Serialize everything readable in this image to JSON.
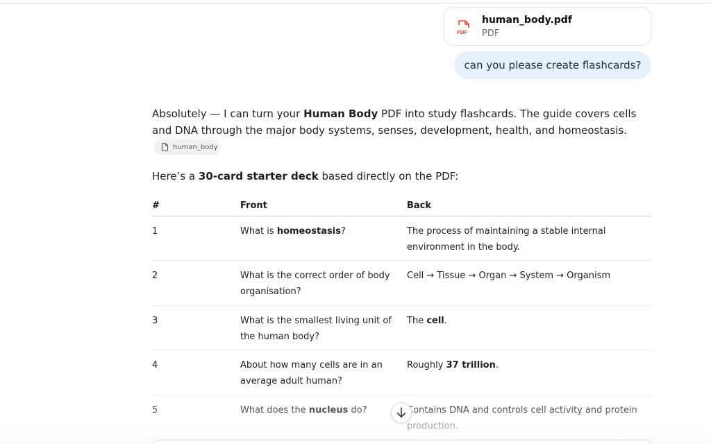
{
  "attachment": {
    "file_name": "human_body.pdf",
    "file_type": "PDF",
    "icon": "pdf-file-icon",
    "icon_label": "PDF"
  },
  "user_message": "can you please create flashcards?",
  "assistant": {
    "intro_before_bold": "Absolutely — I can turn your ",
    "intro_bold": "Human Body",
    "intro_after_bold": " PDF into study flashcards. The guide covers cells and DNA through the major body systems, senses, development, health, and homeostasis.",
    "source_chip": "human_body",
    "deck_before_bold": "Here’s a ",
    "deck_bold": "30-card starter deck",
    "deck_after_bold": " based directly on the PDF:"
  },
  "table": {
    "headers": [
      "#",
      "Front",
      "Back"
    ],
    "rows": [
      {
        "num": "1",
        "front": [
          {
            "t": "What is "
          },
          {
            "t": "homeostasis",
            "b": true
          },
          {
            "t": "?"
          }
        ],
        "back": [
          {
            "t": "The process of maintaining a stable internal environment in the body."
          }
        ]
      },
      {
        "num": "2",
        "front": [
          {
            "t": "What is the correct order of body organisation?"
          }
        ],
        "back": [
          {
            "t": "Cell → Tissue → Organ → System → Organism"
          }
        ]
      },
      {
        "num": "3",
        "front": [
          {
            "t": "What is the smallest living unit of the human body?"
          }
        ],
        "back": [
          {
            "t": "The "
          },
          {
            "t": "cell",
            "b": true
          },
          {
            "t": "."
          }
        ]
      },
      {
        "num": "4",
        "front": [
          {
            "t": "About how many cells are in an average adult human?"
          }
        ],
        "back": [
          {
            "t": "Roughly "
          },
          {
            "t": "37 trillion",
            "b": true
          },
          {
            "t": "."
          }
        ]
      },
      {
        "num": "5",
        "front": [
          {
            "t": "What does the "
          },
          {
            "t": "nucleus",
            "b": true
          },
          {
            "t": " do?"
          }
        ],
        "back": [
          {
            "t": "Contains DNA and controls cell activity and protein production."
          }
        ]
      }
    ]
  },
  "icons": {
    "scroll_down": "arrow-down-icon",
    "source_chip": "document-icon"
  },
  "colors": {
    "user_bubble": "#e7f1fb",
    "pdf_icon": "#e0452f"
  }
}
